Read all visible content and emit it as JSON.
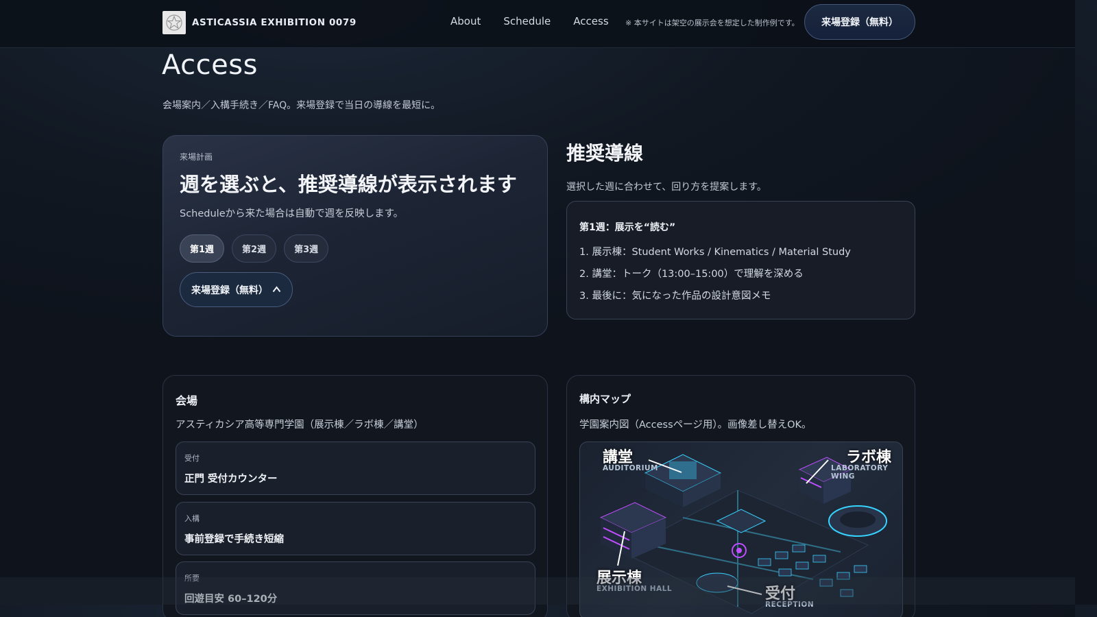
{
  "header": {
    "brand": "ASTICASSIA EXHIBITION 0079",
    "nav": [
      "About",
      "Schedule",
      "Access"
    ],
    "notice": "※ 本サイトは架空の展示会を想定した制作例です。",
    "cta": "来場登録（無料）"
  },
  "page": {
    "title": "Access",
    "subtitle": "会場案内／入構手続き／FAQ。来場登録で当日の導線を最短に。"
  },
  "plan": {
    "eyebrow": "来場計画",
    "heading": "週を選ぶと、推奨導線が表示されます",
    "desc": "Scheduleから来た場合は自動で週を反映します。",
    "weeks": [
      "第1週",
      "第2週",
      "第3週"
    ],
    "selected_week": "第1週",
    "cta": "来場登録（無料）",
    "cta_icon": "chevron-up"
  },
  "route": {
    "title": "推奨導線",
    "subtitle": "選択した週に合わせて、回り方を提案します。",
    "card_title": "第1週：展示を“読む”",
    "steps": [
      "1. 展示棟：Student Works / Kinematics / Material Study",
      "2. 講堂：トーク（13:00–15:00）で理解を深める",
      "3. 最後に：気になった作品の設計意図メモ"
    ]
  },
  "venue": {
    "title": "会場",
    "desc": "アスティカシア高等専門学園（展示棟／ラボ棟／講堂）",
    "items": [
      {
        "label": "受付",
        "value": "正門 受付カウンター"
      },
      {
        "label": "入構",
        "value": "事前登録で手続き短縮"
      },
      {
        "label": "所要",
        "value": "回遊目安 60–120分"
      }
    ]
  },
  "map": {
    "title": "構内マップ",
    "desc": "学園案内図（Accessページ用）。画像差し替えOK。",
    "labels": {
      "auditorium": "講堂",
      "auditorium_en": "AUDITORIUM",
      "lab": "ラボ棟",
      "lab_en": "LABORATORY WING",
      "hall": "展示棟",
      "hall_en": "EXHIBITION HALL",
      "reception": "受付",
      "reception_en": "RECEPTION"
    }
  },
  "colors": {
    "accent_cyan": "#37d3ff",
    "accent_magenta": "#c04dff",
    "background": "#111822"
  }
}
